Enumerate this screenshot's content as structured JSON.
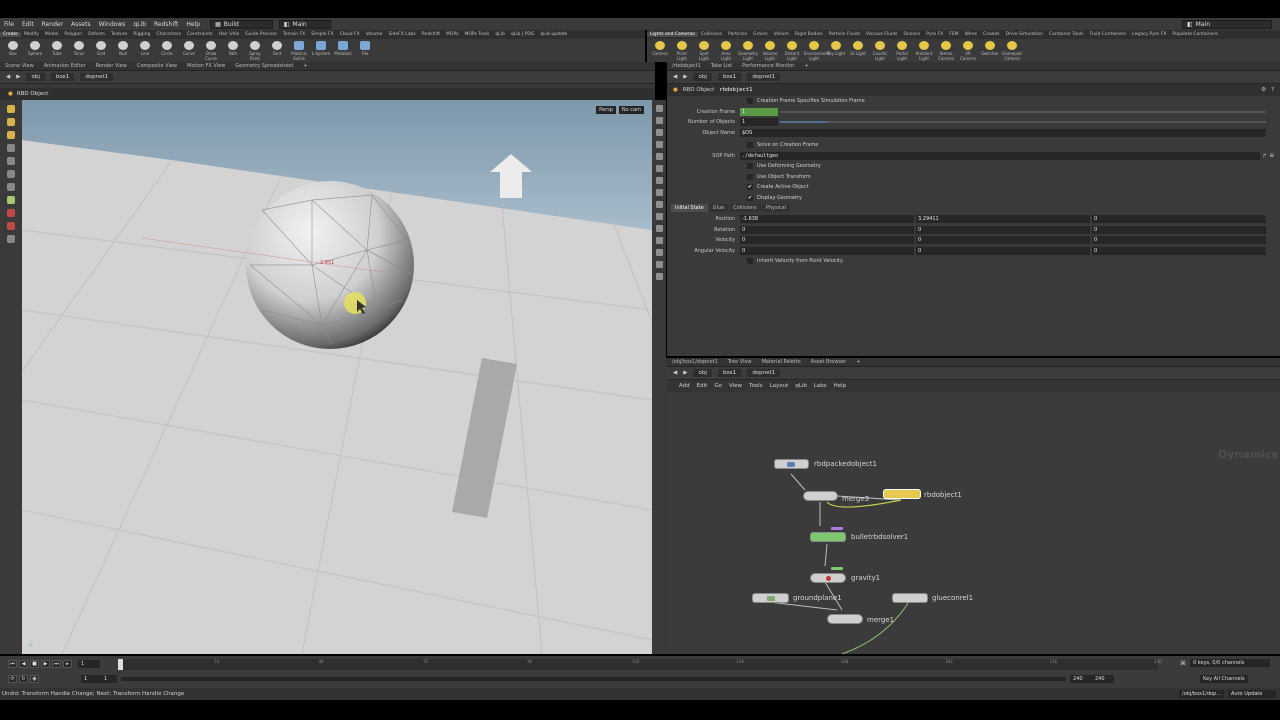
{
  "menu": [
    "File",
    "Edit",
    "Render",
    "Assets",
    "Windows",
    "qLib",
    "Redshift",
    "Help"
  ],
  "desktop": {
    "build": "Build",
    "main": "Main",
    "right_main": "Main"
  },
  "shelf_left": {
    "tabs": [
      "Create",
      "Modify",
      "Model",
      "Polygon",
      "Deform",
      "Texture",
      "Rigging",
      "Characters",
      "Constraints",
      "Hair Utils",
      "Guide Process",
      "Terrain FX",
      "Simple FX",
      "Cloud FX",
      "Volume",
      "SideFX Labs",
      "Redshift",
      "MOPs",
      "MOPs Tools",
      "qLib",
      "qLib | PDG",
      "qLib-update"
    ],
    "tools": [
      {
        "label": "Box",
        "icon": "box-icon"
      },
      {
        "label": "Sphere",
        "icon": "sphere-icon"
      },
      {
        "label": "Tube",
        "icon": "tube-icon"
      },
      {
        "label": "Torus",
        "icon": "torus-icon"
      },
      {
        "label": "Grid",
        "icon": "grid-icon"
      },
      {
        "label": "Null",
        "icon": "null-icon"
      },
      {
        "label": "Line",
        "icon": "line-icon"
      },
      {
        "label": "Circle",
        "icon": "circle-icon"
      },
      {
        "label": "Curve",
        "icon": "curve-icon"
      },
      {
        "label": "Draw Curve",
        "icon": "draw-curve-icon"
      },
      {
        "label": "Path",
        "icon": "path-icon"
      },
      {
        "label": "Spray Paint",
        "icon": "spray-paint-icon"
      },
      {
        "label": "Font",
        "icon": "font-icon"
      },
      {
        "label": "Platonic Solids",
        "icon": "platonic-icon"
      },
      {
        "label": "L-System",
        "icon": "lsystem-icon"
      },
      {
        "label": "Metaball",
        "icon": "metaball-icon"
      },
      {
        "label": "File",
        "icon": "file-icon"
      }
    ]
  },
  "shelf_right": {
    "tabs": [
      "Lights and Cameras",
      "Collisions",
      "Particles",
      "Grains",
      "Vellum",
      "Rigid Bodies",
      "Particle Fluids",
      "Viscous Fluids",
      "Oceans",
      "Pyro FX",
      "FEM",
      "Wires",
      "Crowds",
      "Drive Simulation",
      "Container Tools",
      "Fluid Containers",
      "Legacy Pyro FX",
      "Populate Containers"
    ],
    "tools": [
      {
        "label": "Camera",
        "icon": "camera-icon"
      },
      {
        "label": "Point Light",
        "icon": "point-light-icon"
      },
      {
        "label": "Spot Light",
        "icon": "spot-light-icon"
      },
      {
        "label": "Area Light",
        "icon": "area-light-icon"
      },
      {
        "label": "Geometry Light",
        "icon": "geometry-light-icon"
      },
      {
        "label": "Volume Light",
        "icon": "volume-light-icon"
      },
      {
        "label": "Distant Light",
        "icon": "distant-light-icon"
      },
      {
        "label": "Environment Light",
        "icon": "environment-light-icon"
      },
      {
        "label": "Sky Light",
        "icon": "sky-light-icon"
      },
      {
        "label": "GI Light",
        "icon": "gi-light-icon"
      },
      {
        "label": "Caustic Light",
        "icon": "caustic-light-icon"
      },
      {
        "label": "Portal Light",
        "icon": "portal-light-icon"
      },
      {
        "label": "Ambient Light",
        "icon": "ambient-light-icon"
      },
      {
        "label": "Stereo Camera",
        "icon": "stereo-camera-icon"
      },
      {
        "label": "VR Camera",
        "icon": "vr-camera-icon"
      },
      {
        "label": "Switcher",
        "icon": "switcher-icon"
      },
      {
        "label": "Gamepad Camera",
        "icon": "gamepad-camera-icon"
      }
    ]
  },
  "left_pane": {
    "tabs": [
      "Scene View",
      "Animation Editor",
      "Render View",
      "Composite View",
      "Motion FX View",
      "Geometry Spreadsheet"
    ],
    "path": [
      "obj",
      "box1",
      "dopnet1"
    ],
    "title": "RBD Object",
    "persp": "Persp",
    "cam": "No cam",
    "handle_readout": "2.851"
  },
  "right_pane": {
    "tabs": [
      "/rbdobject1",
      "Take List",
      "Performance Monitor"
    ],
    "path": [
      "obj",
      "box1",
      "dopnet1"
    ],
    "node_type": "RBD Object",
    "node_name": "rbdobject1",
    "creation_frame_specifies": "Creation Frame Specifies Simulation Frame",
    "creation_frame_label": "Creation Frame",
    "creation_frame_value": "1",
    "number_of_objects_label": "Number of Objects",
    "number_of_objects_value": "1",
    "object_name_label": "Object Name",
    "object_name_value": "$OS",
    "solve_on_creation": "Solve on Creation Frame",
    "sop_path_label": "SOP Path",
    "sop_path_value": "./defaultgeo",
    "checkboxes": [
      {
        "label": "Use Deforming Geometry",
        "checked": false
      },
      {
        "label": "Use Object Transform",
        "checked": false
      },
      {
        "label": "Create Active Object",
        "checked": true
      },
      {
        "label": "Display Geometry",
        "checked": true
      }
    ],
    "subtabs": [
      "Initial State",
      "Glue",
      "Collisions",
      "Physical"
    ],
    "vectors": [
      {
        "label": "Position",
        "values": [
          "-1.638",
          "3.29411",
          "0"
        ]
      },
      {
        "label": "Rotation",
        "values": [
          "0",
          "0",
          "0"
        ]
      },
      {
        "label": "Velocity",
        "values": [
          "0",
          "0",
          "0"
        ]
      },
      {
        "label": "Angular Velocity",
        "values": [
          "0",
          "0",
          "0"
        ]
      }
    ],
    "inherit": "Inherit Velocity from Point Velocity"
  },
  "network": {
    "tabs": [
      "/obj/box1/dopnet1",
      "Tree View",
      "Material Palette",
      "Asset Browser"
    ],
    "path": [
      "obj",
      "box1",
      "dopnet1"
    ],
    "menu": [
      "Add",
      "Edit",
      "Go",
      "View",
      "Tools",
      "Layout",
      "qLib",
      "Labs",
      "Help"
    ],
    "context": "Dynamics",
    "nodes": {
      "rbdpacked": "rbdpackedobject1",
      "merge_top": "merge3",
      "rbdobject": "rbdobject1",
      "solver": "bulletrbdsolver1",
      "gravity": "gravity1",
      "groundplane": "groundplane1",
      "glue": "glueconrel1",
      "merge_bottom": "merge1"
    }
  },
  "timeline": {
    "ticks": [
      "24",
      "48",
      "72",
      "96",
      "120",
      "144",
      "168",
      "192",
      "216",
      "240"
    ],
    "frame": "1",
    "start": "1",
    "start2": "1",
    "end": "240",
    "end2": "240",
    "keys": "0 keys, 0/0 channels",
    "key_all": "Key All Channels"
  },
  "status": {
    "message": "Undid: Transform Handle Change; Next: Transform Handle Change",
    "path": "/obj/box1/dop...",
    "update": "Auto Update"
  }
}
